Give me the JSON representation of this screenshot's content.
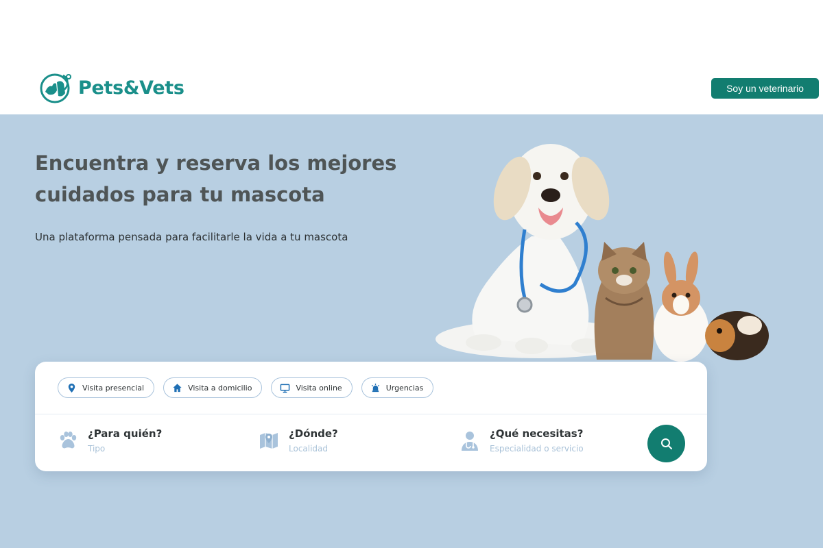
{
  "header": {
    "brand": "Pets&Vets",
    "vet_button_label": "Soy un veterinario"
  },
  "hero": {
    "title": "Encuentra y reserva los mejores cuidados para tu mascota",
    "subtitle": "Una plataforma pensada para facilitarle la vida a tu mascota"
  },
  "search": {
    "chips": [
      {
        "label": "Visita presencial",
        "icon": "location-pin-icon"
      },
      {
        "label": "Visita a domicilio",
        "icon": "home-icon"
      },
      {
        "label": "Visita online",
        "icon": "monitor-icon"
      },
      {
        "label": "Urgencias",
        "icon": "alarm-icon"
      }
    ],
    "fields": [
      {
        "label": "¿Para quién?",
        "hint": "Tipo",
        "icon": "paw-icon"
      },
      {
        "label": "¿Dónde?",
        "hint": "Localidad",
        "icon": "map-icon"
      },
      {
        "label": "¿Qué necesitas?",
        "hint": "Especialidad o servicio",
        "icon": "doctor-icon"
      }
    ],
    "submit_icon": "search-icon"
  },
  "colors": {
    "brand": "#1a8f8a",
    "button": "#127d70",
    "hero_bg": "#b8cfe2",
    "chip_border": "#a9c3dc",
    "hint": "#a9c2d8"
  }
}
